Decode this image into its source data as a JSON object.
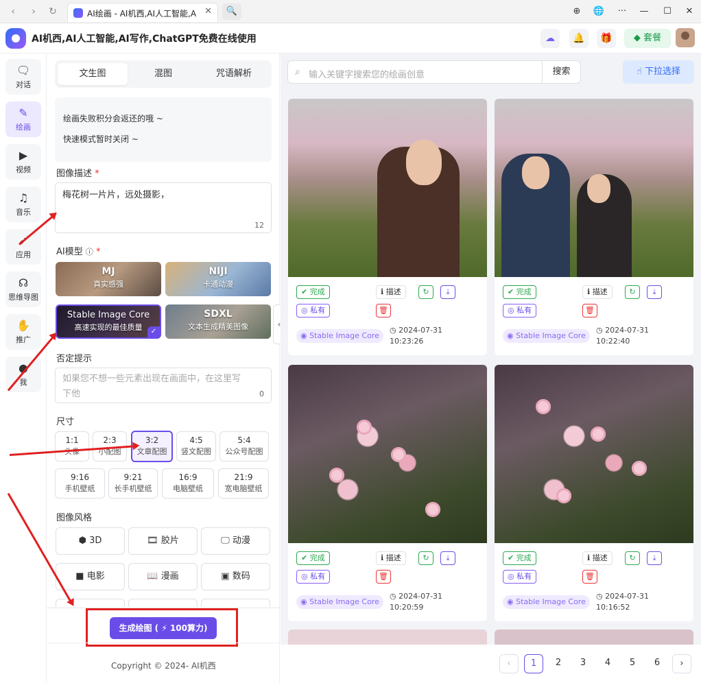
{
  "browser": {
    "tab_title": "AI绘画 - AI机西,AI人工智能,A",
    "nav": {
      "back": "‹",
      "forward": "›",
      "reload": "↻",
      "close": "✕",
      "search": "🔍"
    },
    "controls": {
      "download": "⊕",
      "globe": "🌐",
      "more": "···",
      "minimize": "—",
      "maximize": "☐",
      "close": "✕"
    }
  },
  "header": {
    "title": "AI机西,AI人工智能,AI写作,ChatGPT免费在线使用",
    "plan_label": "套餐"
  },
  "sidebar": {
    "items": [
      {
        "label": "对话",
        "icon": "chat-icon"
      },
      {
        "label": "绘画",
        "icon": "brush-icon"
      },
      {
        "label": "视频",
        "icon": "video-icon"
      },
      {
        "label": "音乐",
        "icon": "music-icon"
      },
      {
        "label": "应用",
        "icon": "rocket-icon"
      },
      {
        "label": "思维导图",
        "icon": "mindmap-icon"
      },
      {
        "label": "推广",
        "icon": "handshake-icon"
      },
      {
        "label": "我",
        "icon": "user-icon"
      }
    ]
  },
  "panel": {
    "tabs": [
      "文生图",
      "混图",
      "咒语解析"
    ],
    "notices": [
      "绘画失败积分会返还的哦 ~",
      "快速模式暂时关闭 ~"
    ],
    "desc_label": "图像描述",
    "desc_value": "梅花树一片片，远处摄影，",
    "desc_count": "12",
    "model_label": "AI模型",
    "models": [
      {
        "name": "MJ",
        "desc": "真实感强"
      },
      {
        "name": "NIJI",
        "desc": "卡通动漫"
      },
      {
        "name": "Stable Image Core",
        "desc": "高速实现的最佳质量"
      },
      {
        "name": "SDXL",
        "desc": "文本生成精美图像"
      }
    ],
    "neg_label": "否定提示",
    "neg_placeholder": "如果您不想一些元素出现在画面中，在这里写下他",
    "neg_count": "0",
    "size_label": "尺寸",
    "sizes": [
      {
        "ratio": "1:1",
        "name": "头像"
      },
      {
        "ratio": "2:3",
        "name": "小配图"
      },
      {
        "ratio": "3:2",
        "name": "文章配图"
      },
      {
        "ratio": "4:5",
        "name": "竖文配图"
      },
      {
        "ratio": "5:4",
        "name": "公众号配图"
      },
      {
        "ratio": "9:16",
        "name": "手机壁纸"
      },
      {
        "ratio": "9:21",
        "name": "长手机壁纸"
      },
      {
        "ratio": "16:9",
        "name": "电脑壁纸"
      },
      {
        "ratio": "21:9",
        "name": "宽电脑壁纸"
      }
    ],
    "style_label": "图像风格",
    "styles": [
      {
        "icon": "⬢",
        "label": "3D"
      },
      {
        "icon": "🎞",
        "label": "胶片"
      },
      {
        "icon": "🖵",
        "label": "动漫"
      },
      {
        "icon": "■",
        "label": "电影"
      },
      {
        "icon": "📖",
        "label": "漫画"
      },
      {
        "icon": "▣",
        "label": "数码"
      }
    ],
    "generate_label": "生成绘图 ( ⚡ 100算力)",
    "copyright": "Copyright © 2024-  AI机西"
  },
  "main": {
    "search_placeholder": "输入关键字搜索您的绘画创意",
    "search_button": "搜索",
    "pull_label": "下拉选择",
    "card_labels": {
      "done": "完成",
      "private": "私有",
      "desc": "描述"
    },
    "cards": [
      {
        "model": "Stable Image Core",
        "date": "2024-07-31",
        "time": "10:23:26"
      },
      {
        "model": "Stable Image Core",
        "date": "2024-07-31",
        "time": "10:22:40"
      },
      {
        "model": "Stable Image Core",
        "date": "2024-07-31",
        "time": "10:20:59"
      },
      {
        "model": "Stable Image Core",
        "date": "2024-07-31",
        "time": "10:16:52"
      }
    ],
    "pages": [
      "1",
      "2",
      "3",
      "4",
      "5",
      "6"
    ],
    "prev": "‹",
    "next": "›"
  }
}
